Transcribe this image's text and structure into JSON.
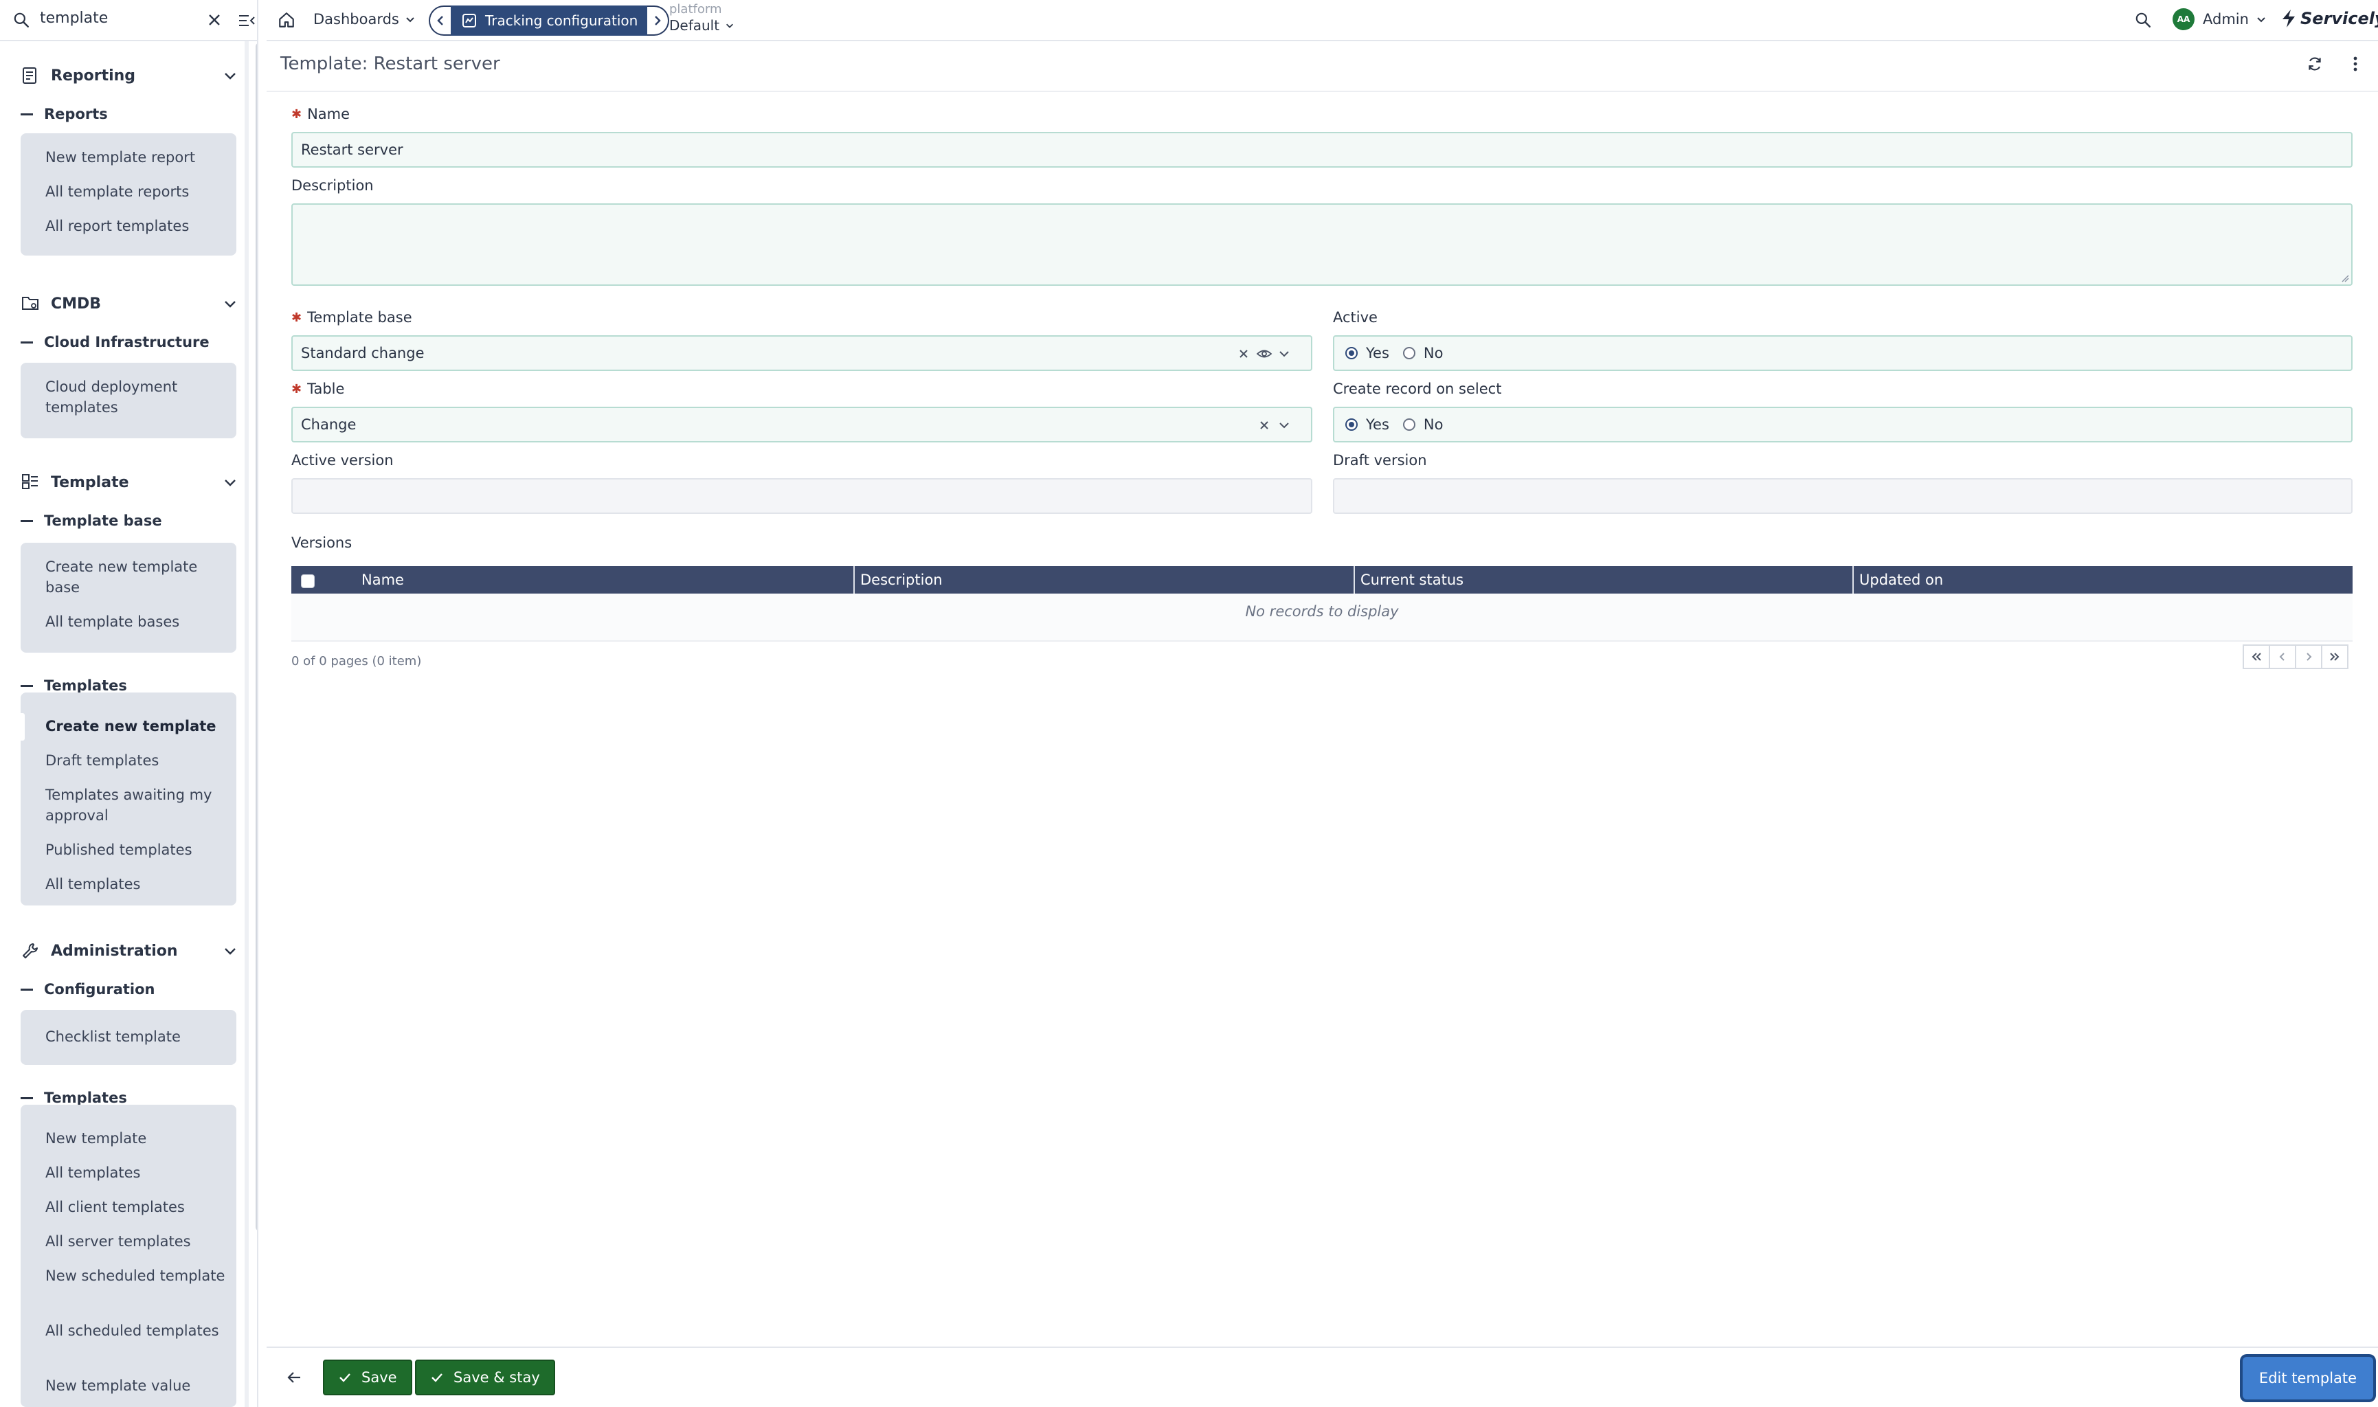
{
  "sidebar": {
    "search": {
      "value": "template"
    },
    "sections": [
      {
        "title": "Reporting",
        "groups": [
          {
            "title": "Reports",
            "items": [
              "New template report",
              "All template reports",
              "All report templates"
            ]
          }
        ]
      },
      {
        "title": "CMDB",
        "groups": [
          {
            "title": "Cloud Infrastructure",
            "items": [
              "Cloud deployment templates"
            ]
          }
        ]
      },
      {
        "title": "Template",
        "groups": [
          {
            "title": "Template base",
            "items": [
              "Create new template base",
              "All template bases"
            ]
          },
          {
            "title": "Templates",
            "items": [
              "Create new template",
              "Draft templates",
              "Templates awaiting my approval",
              "Published templates",
              "All templates"
            ]
          }
        ]
      },
      {
        "title": "Administration",
        "groups": [
          {
            "title": "Configuration",
            "items": [
              "Checklist template"
            ]
          },
          {
            "title": "Templates",
            "items": [
              "New template",
              "All templates",
              "All client templates",
              "All server templates",
              "New scheduled template",
              "All scheduled templates",
              "New template value"
            ]
          }
        ]
      }
    ]
  },
  "topbar": {
    "dashboards_label": "Dashboards",
    "active_tab": "Tracking configuration",
    "platform_small": "platform",
    "platform_value": "Default",
    "user_initials": "AA",
    "user_name": "Admin",
    "brand": "Servicely"
  },
  "form": {
    "title": "Template: Restart server",
    "name_label": "Name",
    "name_value": "Restart server",
    "description_label": "Description",
    "description_value": "",
    "template_base_label": "Template base",
    "template_base_value": "Standard change",
    "active_label": "Active",
    "active_yes": "Yes",
    "active_no": "No",
    "active_selected": "Yes",
    "table_label": "Table",
    "table_value": "Change",
    "create_record_label": "Create record on select",
    "create_record_yes": "Yes",
    "create_record_no": "No",
    "create_record_selected": "Yes",
    "active_version_label": "Active version",
    "active_version_value": "",
    "draft_version_label": "Draft version",
    "draft_version_value": ""
  },
  "versions": {
    "label": "Versions",
    "columns": [
      "Name",
      "Description",
      "Current status",
      "Updated on"
    ],
    "empty_text": "No records to display",
    "pager_text": "0 of 0 pages (0 item)"
  },
  "footer": {
    "save": "Save",
    "save_stay": "Save & stay",
    "edit": "Edit template"
  },
  "colors": {
    "accent": "#2e4a7a",
    "table_header": "#3d4a6b",
    "save_green": "#1e6b2b",
    "edit_blue": "#3f7ecf",
    "required": "#c0392b"
  }
}
